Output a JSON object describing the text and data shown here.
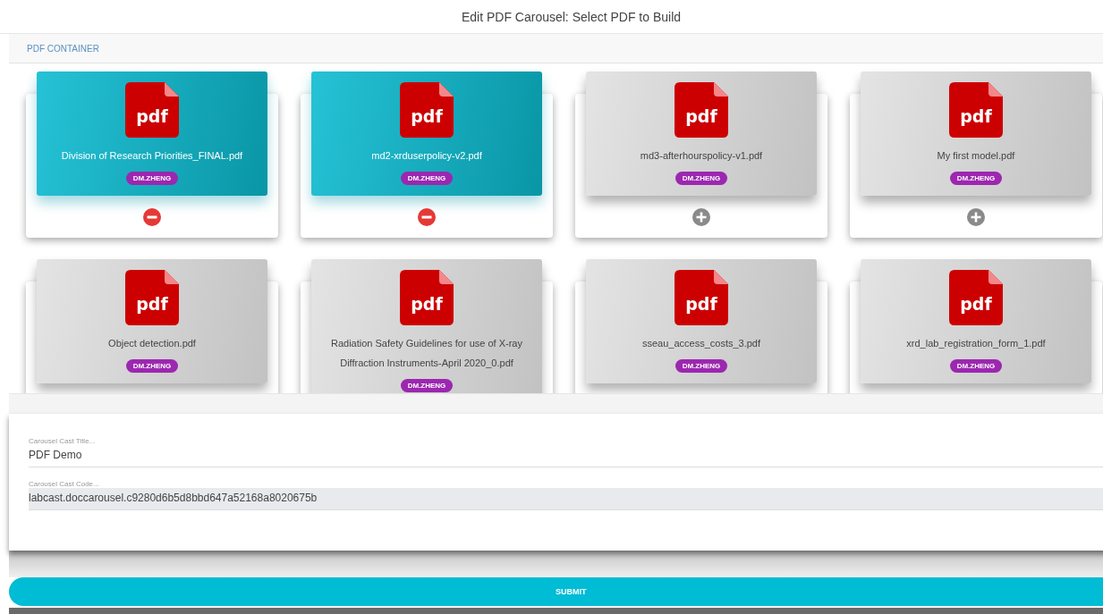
{
  "title": "Edit PDF Carousel: Select PDF to Build",
  "container": {
    "label": "PDF CONTAINER"
  },
  "pdfs": [
    {
      "icon_text": "pdf",
      "name": "Division of Research Priorities_FINAL.pdf",
      "owner": "DM.ZHENG",
      "selected": true,
      "kind": "removable"
    },
    {
      "icon_text": "pdf",
      "name": "md2-xrduserpolicy-v2.pdf",
      "owner": "DM.ZHENG",
      "selected": true,
      "kind": "removable"
    },
    {
      "icon_text": "pdf",
      "name": "md3-afterhourspolicy-v1.pdf",
      "owner": "DM.ZHENG",
      "selected": false,
      "kind": "addable"
    },
    {
      "icon_text": "pdf",
      "name": "My first model.pdf",
      "owner": "DM.ZHENG",
      "selected": false,
      "kind": "addable"
    },
    {
      "icon_text": "pdf",
      "name": "Object detection.pdf",
      "owner": "DM.ZHENG",
      "selected": false
    },
    {
      "icon_text": "pdf",
      "name": "Radiation Safety Guidelines for use of X-ray Diffraction Instruments-April 2020_0.pdf",
      "owner": "DM.ZHENG",
      "selected": false
    },
    {
      "icon_text": "pdf",
      "name": "sseau_access_costs_3.pdf",
      "owner": "DM.ZHENG",
      "selected": false
    },
    {
      "icon_text": "pdf",
      "name": "xrd_lab_registration_form_1.pdf",
      "owner": "DM.ZHENG",
      "selected": false
    }
  ],
  "form": {
    "fields": [
      {
        "kind": "text",
        "label": "Carousel Cast Title...",
        "value": "PDF Demo"
      },
      {
        "kind": "readonly",
        "label": "Carousel Cast Code...",
        "value": "labcast.doccarousel.c9280d6b5d8bbd647a52168a8020675b"
      }
    ]
  },
  "submit": "SUBMIT"
}
